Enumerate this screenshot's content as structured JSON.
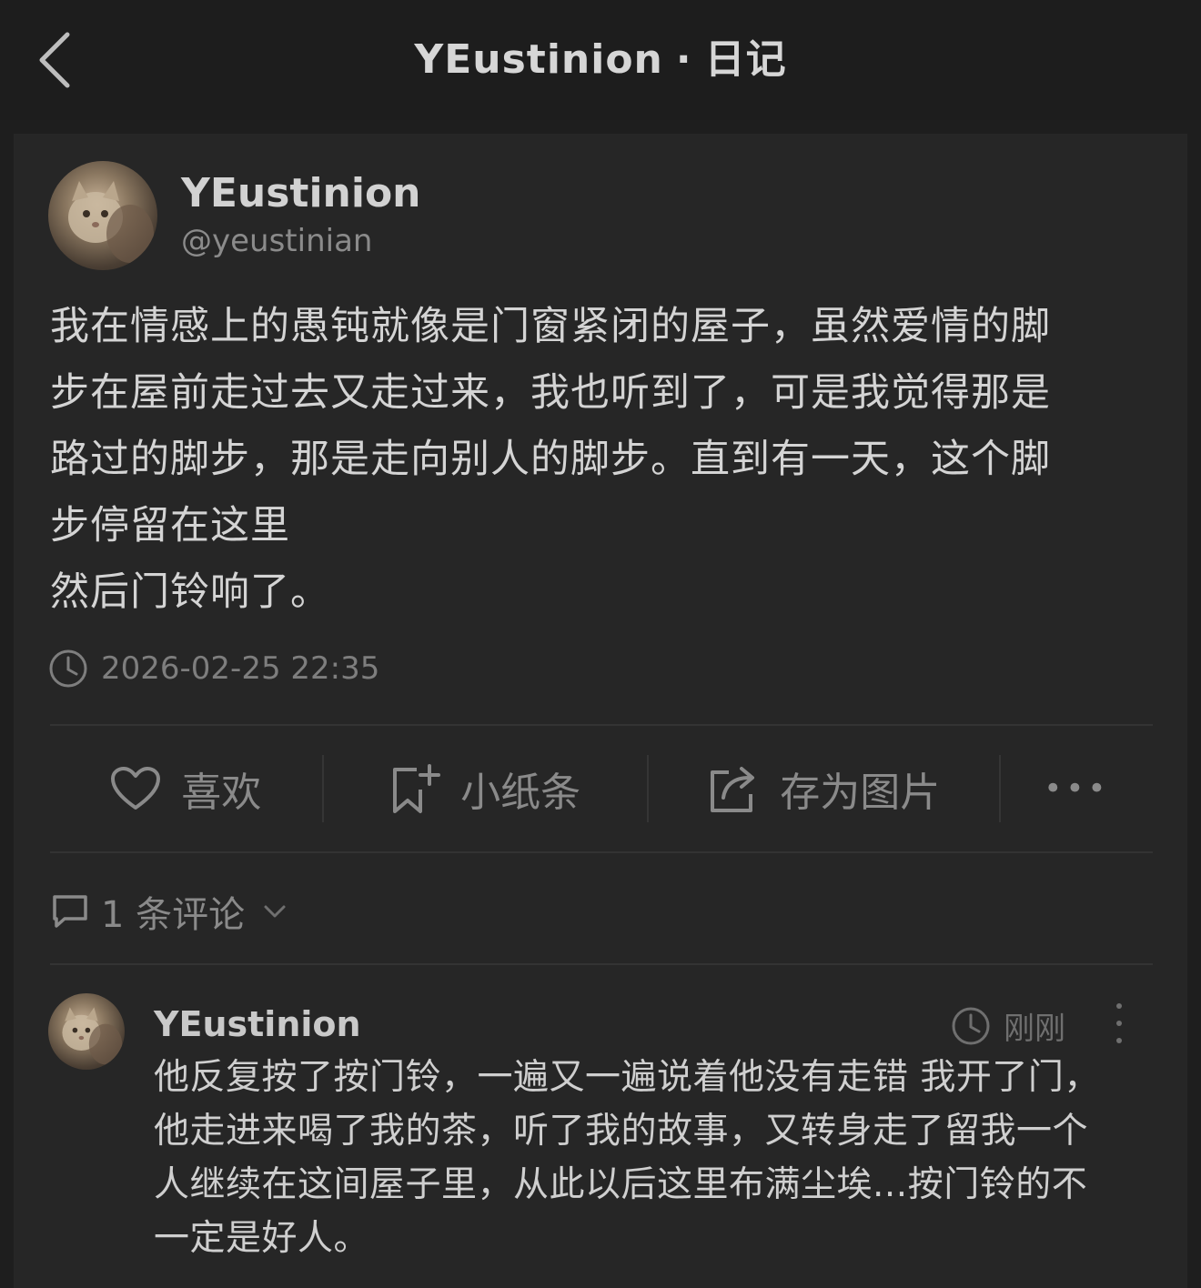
{
  "header": {
    "title_user": "YEustinion",
    "title_separator": "·",
    "title_section": "日记"
  },
  "post": {
    "author_name": "YEustinion",
    "author_handle": "@yeustinian",
    "body": "我在情感上的愚钝就像是门窗紧闭的屋子，虽然爱情的脚\n步在屋前走过去又走过来，我也听到了，可是我觉得那是\n路过的脚步，那是走向别人的脚步。直到有一天，这个脚\n步停留在这里\n然后门铃响了。",
    "timestamp": "2026-02-25 22:35"
  },
  "actions": {
    "like": "喜欢",
    "note": "小纸条",
    "save_image": "存为图片",
    "more": "•••"
  },
  "comments": {
    "header": "1 条评论",
    "items": [
      {
        "author": "YEustinion",
        "time": "刚刚",
        "body": "他反复按了按门铃，一遍又一遍说着他没有走错 我开了门，\n他走进来喝了我的茶，听了我的故事，又转身走了留我一个\n人继续在这间屋子里，从此以后这里布满尘埃...按门铃的不\n一定是好人。"
      }
    ]
  },
  "colors": {
    "background": "#1e1e1e",
    "card": "#262626",
    "text_primary": "#d4d4d4",
    "text_muted": "#8a8a8a"
  }
}
